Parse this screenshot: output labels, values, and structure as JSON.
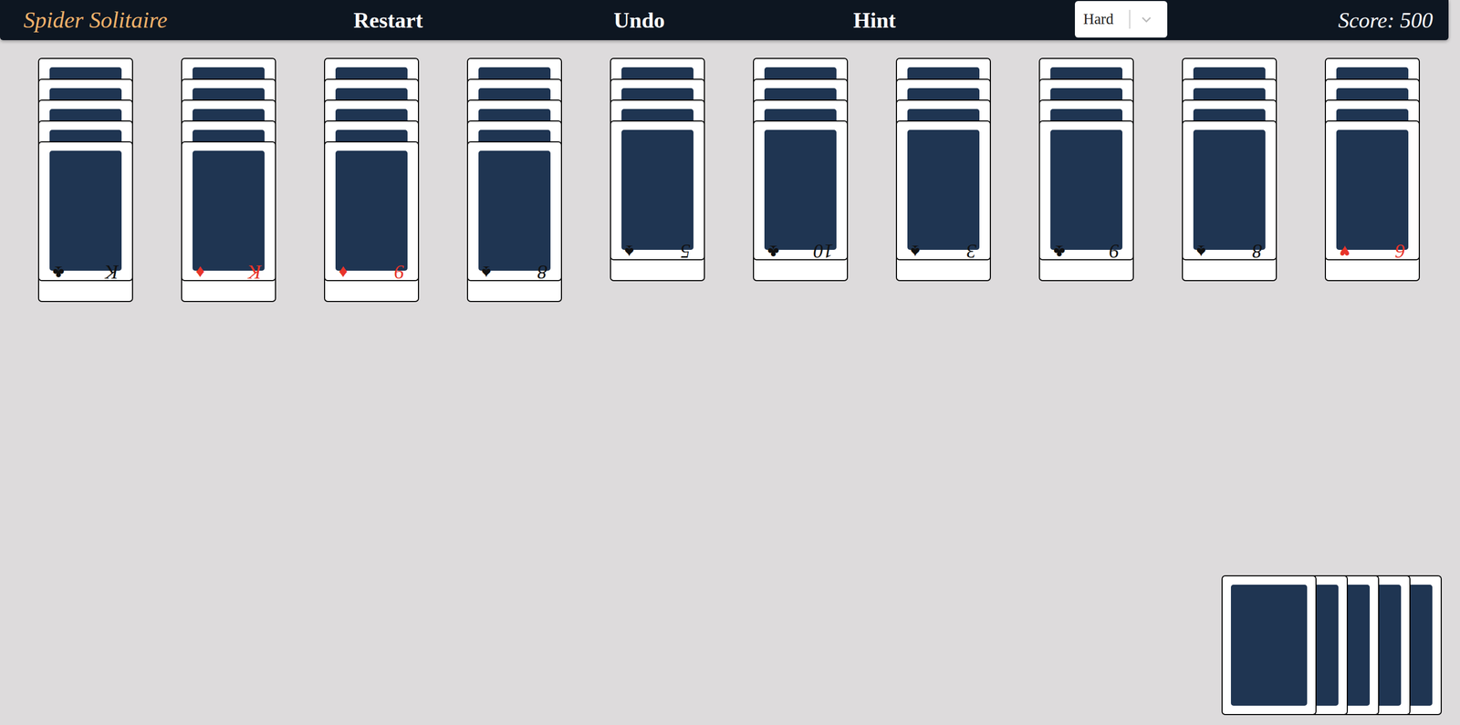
{
  "title": "Spider Solitaire",
  "menu": [
    {
      "label": "Restart"
    },
    {
      "label": "Undo"
    },
    {
      "label": "Hint"
    }
  ],
  "difficulty": {
    "value": "Hard"
  },
  "score": "Score: 500",
  "columns": [
    {
      "face_down": 5,
      "card": {
        "rank": "K",
        "suit": "♣",
        "color": "#111111"
      }
    },
    {
      "face_down": 5,
      "card": {
        "rank": "K",
        "suit": "♦",
        "color": "#e8342a"
      }
    },
    {
      "face_down": 5,
      "card": {
        "rank": "9",
        "suit": "♦",
        "color": "#e8342a"
      }
    },
    {
      "face_down": 5,
      "card": {
        "rank": "8",
        "suit": "♠",
        "color": "#111111"
      }
    },
    {
      "face_down": 4,
      "card": {
        "rank": "5",
        "suit": "♠",
        "color": "#111111"
      }
    },
    {
      "face_down": 4,
      "card": {
        "rank": "10",
        "suit": "♣",
        "color": "#111111"
      }
    },
    {
      "face_down": 4,
      "card": {
        "rank": "3",
        "suit": "♠",
        "color": "#111111"
      }
    },
    {
      "face_down": 4,
      "card": {
        "rank": "9",
        "suit": "♣",
        "color": "#111111"
      }
    },
    {
      "face_down": 4,
      "card": {
        "rank": "8",
        "suit": "♠",
        "color": "#111111"
      }
    },
    {
      "face_down": 4,
      "card": {
        "rank": "6",
        "suit": "♥",
        "color": "#e8342a"
      }
    }
  ],
  "stock": {
    "piles": 5
  }
}
